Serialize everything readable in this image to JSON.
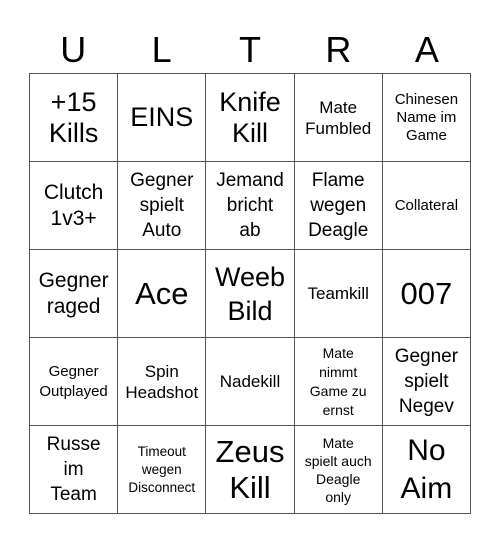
{
  "header": {
    "letters": [
      "U",
      "L",
      "T",
      "R",
      "A"
    ]
  },
  "board": {
    "rows": [
      [
        "+15\nKills",
        "EINS",
        "Knife\nKill",
        "Mate\nFumbled",
        "Chinesen\nName im\nGame"
      ],
      [
        "Clutch\n1v3+",
        "Gegner\nspielt\nAuto",
        "Jemand\nbricht\nab",
        "Flame\nwegen\nDeagle",
        "Collateral"
      ],
      [
        "Gegner\nraged",
        "Ace",
        "Weeb\nBild",
        "Teamkill",
        "007"
      ],
      [
        "Gegner\nOutplayed",
        "Spin\nHeadshot",
        "Nadekill",
        "Mate\nnimmt\nGame zu\nernst",
        "Gegner\nspielt\nNegev"
      ],
      [
        "Russe\nim\nTeam",
        "Timeout\nwegen\nDisconnect",
        "Zeus\nKill",
        "Mate\nspielt auch\nDeagle\nonly",
        "No\nAim"
      ]
    ]
  }
}
